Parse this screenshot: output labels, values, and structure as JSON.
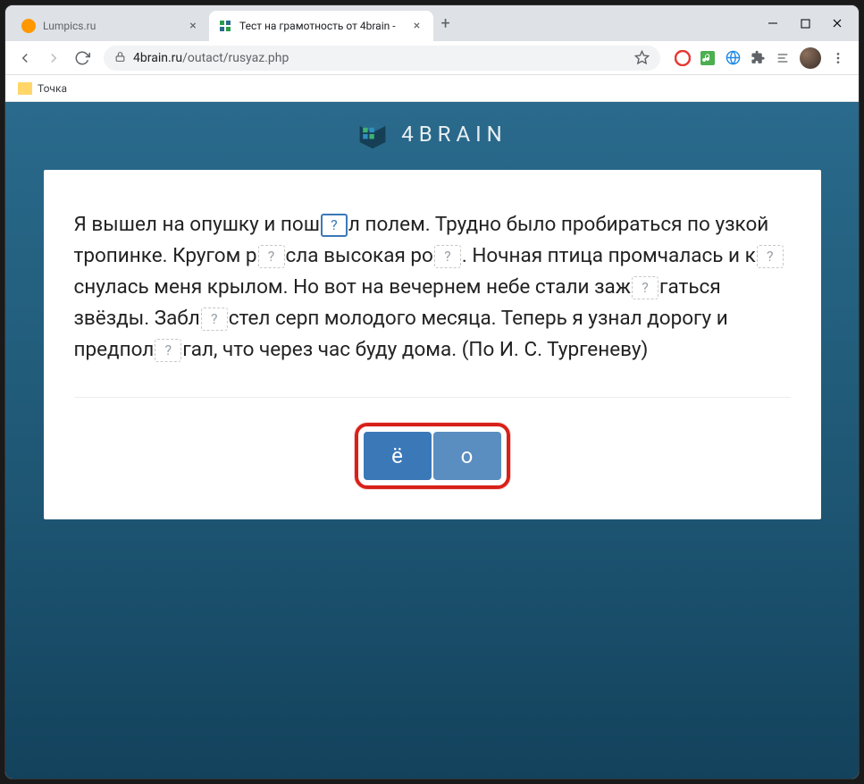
{
  "window": {
    "tabs": [
      {
        "title": "Lumpics.ru",
        "active": false
      },
      {
        "title": "Тест на грамотность от 4brain - ",
        "active": true
      }
    ]
  },
  "toolbar": {
    "url_domain": "4brain.ru",
    "url_path": "/outact/rusyaz.php"
  },
  "bookmarks": {
    "item1": "Точка"
  },
  "brand": {
    "name": "4BRAIN"
  },
  "question": {
    "parts": [
      "Я вышел на опушку и пош",
      "л полем. Трудно было пробираться по узкой тропинке. Кругом р",
      "сла высокая ро",
      ". Ночная птица промчалась и к",
      "снулась меня крылом. Но вот на вечернем небе стали заж",
      "гаться звёзды. Забл",
      "стел серп молодого месяца. Теперь я узнал дорогу и предпол",
      "гал, что через час буду дома. (По И. С. Тургеневу)"
    ],
    "blank_placeholder": "?"
  },
  "answers": {
    "option1": "ё",
    "option2": "о"
  }
}
